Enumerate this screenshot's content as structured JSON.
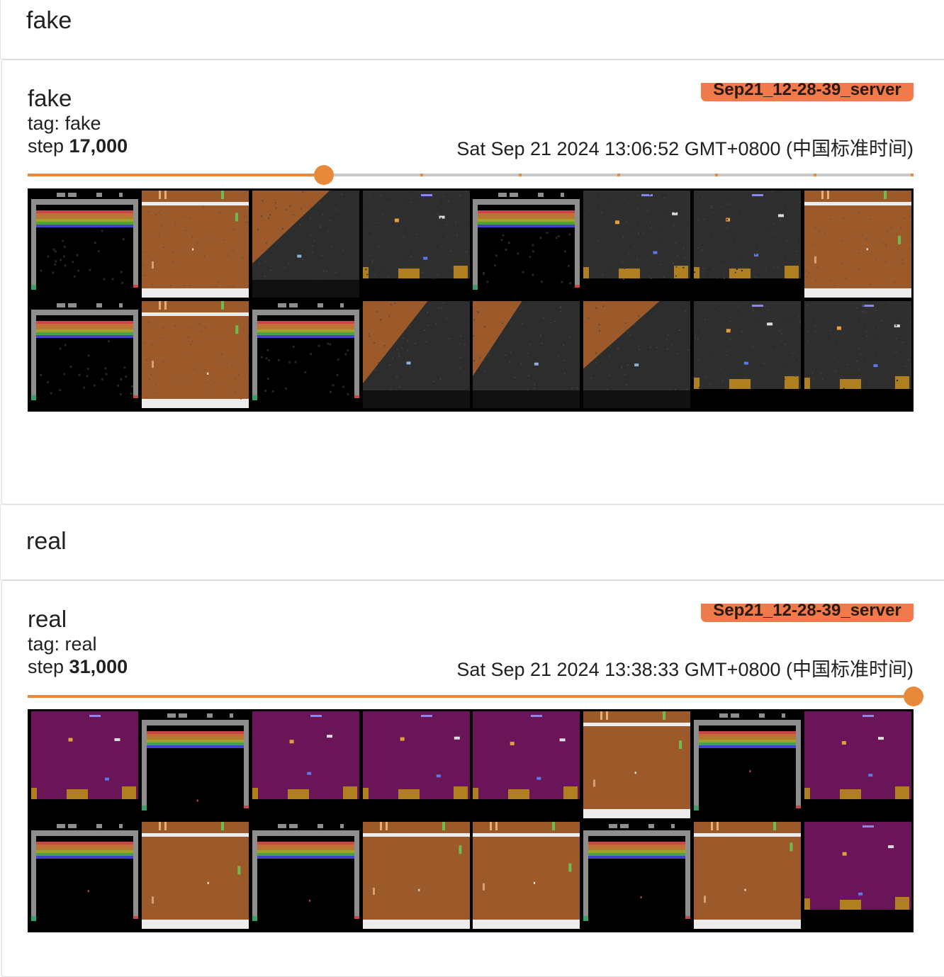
{
  "sections": [
    {
      "group_title": "fake",
      "card": {
        "title": "fake",
        "tag_line": "tag: fake",
        "step_prefix": "step ",
        "step_value": "17,000",
        "run_name": "Sep21_12-28-39_server",
        "timestamp": "Sat Sep 21 2024 13:06:52 GMT+0800 (中国标准时间)",
        "slider_fraction": 0.334,
        "images": [
          [
            "breakout",
            "pong",
            "blend",
            "invaders-dark",
            "breakout",
            "invaders-dark",
            "invaders-dark",
            "pong"
          ],
          [
            "breakout",
            "pong",
            "breakout",
            "blend",
            "blend",
            "blend",
            "invaders-dark",
            "invaders-dark"
          ]
        ]
      }
    },
    {
      "group_title": "real",
      "card": {
        "title": "real",
        "tag_line": "tag: real",
        "step_prefix": "step ",
        "step_value": "31,000",
        "run_name": "Sep21_12-28-39_server",
        "timestamp": "Sat Sep 21 2024 13:38:33 GMT+0800 (中国标准时间)",
        "slider_fraction": 1.0,
        "images": [
          [
            "invaders",
            "breakout",
            "invaders",
            "invaders",
            "invaders",
            "pong",
            "breakout",
            "invaders"
          ],
          [
            "breakout",
            "pong",
            "breakout",
            "pong",
            "pong",
            "breakout",
            "pong",
            "invaders"
          ]
        ]
      }
    }
  ],
  "colors": {
    "accent_orange": "#e8883a",
    "run_badge": "#f07a4c",
    "pong_orange": "#9c5a2a",
    "invaders_purple": "#6b1559",
    "breakout_gray": "#8e8e8e"
  }
}
